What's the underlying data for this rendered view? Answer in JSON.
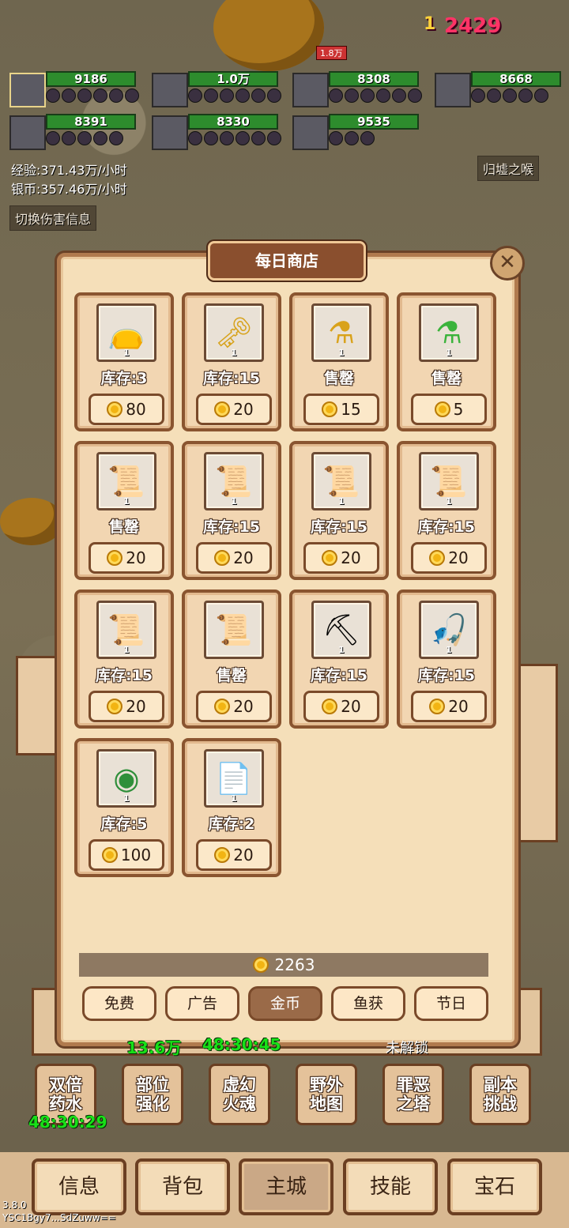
{
  "hud": {
    "heroes": [
      {
        "hp": "9186"
      },
      {
        "hp": "1.0万"
      },
      {
        "hp": "8308"
      },
      {
        "hp": "8668"
      },
      {
        "hp": "8391"
      },
      {
        "hp": "8330"
      },
      {
        "hp": "9535"
      }
    ],
    "exp_rate": "经验:371.43万/小时",
    "silver_rate": "银币:357.46万/小时",
    "toggle_damage_label": "切换伤害信息",
    "zone_label": "归墟之喉",
    "damage_numbers": [
      "1",
      "2429"
    ],
    "enemy_hp": "1.8万"
  },
  "shop": {
    "title": "每日商店",
    "close_icon": "close-icon",
    "items": [
      {
        "icon": "yellow-bag",
        "qty": "1",
        "stock": "库存:3",
        "price": "80"
      },
      {
        "icon": "golden-key",
        "qty": "1",
        "stock": "库存:15",
        "price": "20"
      },
      {
        "icon": "gold-potion",
        "qty": "1",
        "stock": "售罄",
        "price": "15"
      },
      {
        "icon": "green-potion",
        "qty": "1",
        "stock": "售罄",
        "price": "5"
      },
      {
        "icon": "green-scroll",
        "qty": "1",
        "stock": "售罄",
        "price": "20"
      },
      {
        "icon": "red-scroll",
        "qty": "1",
        "stock": "库存:15",
        "price": "20"
      },
      {
        "icon": "orange-scroll",
        "qty": "1",
        "stock": "库存:15",
        "price": "20"
      },
      {
        "icon": "teal-scroll",
        "qty": "1",
        "stock": "库存:15",
        "price": "20"
      },
      {
        "icon": "pink-scroll",
        "qty": "1",
        "stock": "库存:15",
        "price": "20"
      },
      {
        "icon": "plain-scroll",
        "qty": "",
        "stock": "售罄",
        "price": "20"
      },
      {
        "icon": "pickaxe",
        "qty": "1",
        "stock": "库存:15",
        "price": "20"
      },
      {
        "icon": "fishing-rod",
        "qty": "1",
        "stock": "库存:15",
        "price": "20"
      },
      {
        "icon": "green-orb",
        "qty": "1",
        "stock": "库存:5",
        "price": "100"
      },
      {
        "icon": "document",
        "qty": "1",
        "stock": "库存:2",
        "price": "20"
      }
    ],
    "balance": "2263",
    "tabs": [
      "免费",
      "广告",
      "金币",
      "鱼获",
      "节日"
    ],
    "active_tab": "金币"
  },
  "features": {
    "buttons": [
      "双倍\n药水",
      "部位\n强化",
      "虚幻\n火魂",
      "野外\n地图",
      "罪恶\n之塔",
      "副本\n挑战"
    ],
    "double_potion_timer": "48:30:29",
    "partial_timers": [
      "13.6万",
      "48:30:45"
    ],
    "locked_label": "未解锁"
  },
  "nav": {
    "tabs": [
      "信息",
      "背包",
      "主城",
      "技能",
      "宝石"
    ],
    "active": "主城"
  },
  "footer": {
    "version": "3.8.0",
    "device_id": "YSC1Bgy7...SdZuww=="
  },
  "colors": {
    "panel_bg": "#f5dfb9",
    "panel_border": "#8a5530",
    "hp_green": "#2d8c2d",
    "timer_green": "#18e018",
    "damage_red": "#ff3366"
  }
}
